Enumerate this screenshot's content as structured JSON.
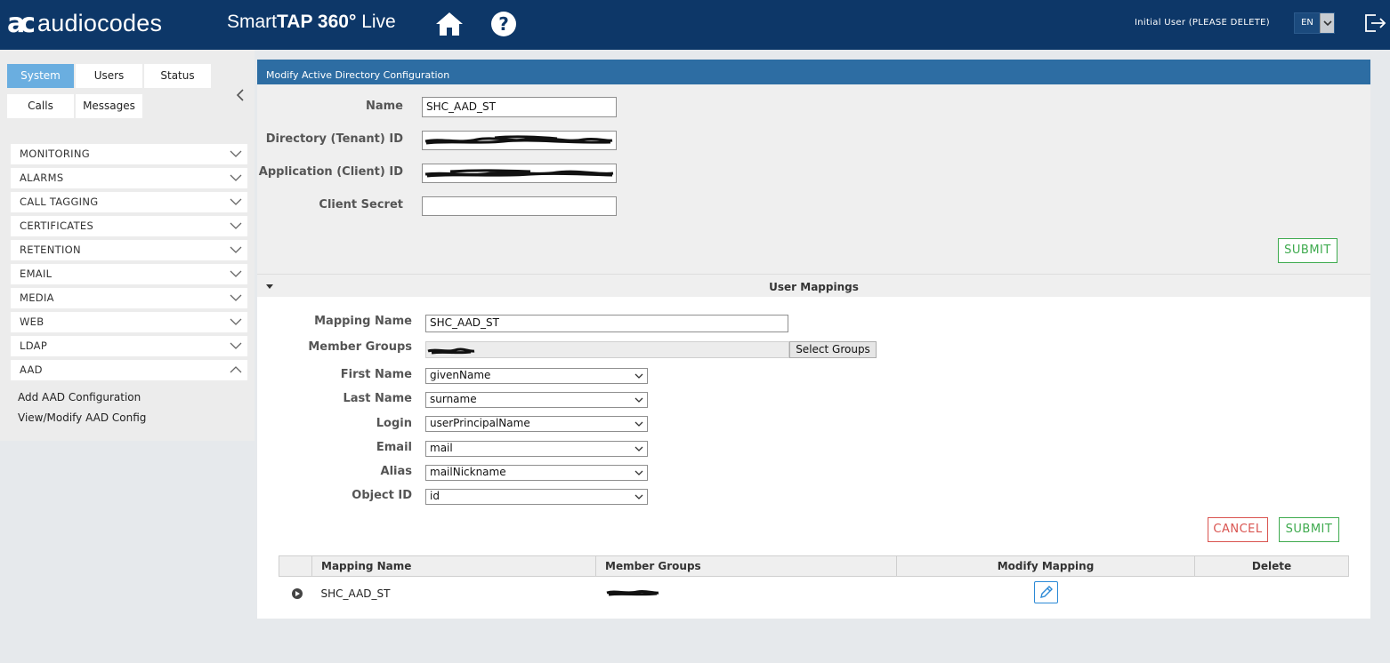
{
  "header": {
    "logo_mark": "ac",
    "logo_text": "audiocodes",
    "product_prefix": "Smart",
    "product_bold": "TAP 360°",
    "product_suffix": "Live",
    "user_label": "Initial User (PLEASE DELETE)",
    "language": "EN",
    "icons": [
      "home-icon",
      "help-icon",
      "logout-icon"
    ]
  },
  "sidebar": {
    "tabs_row1": [
      "System",
      "Users",
      "Status"
    ],
    "tabs_row2": [
      "Calls",
      "Messages"
    ],
    "active_tab": "System",
    "sections": [
      "MONITORING",
      "ALARMS",
      "CALL TAGGING",
      "CERTIFICATES",
      "RETENTION",
      "EMAIL",
      "MEDIA",
      "WEB",
      "LDAP",
      "AAD"
    ],
    "expanded_section": "AAD",
    "aad_links": [
      "Add AAD Configuration",
      "View/Modify AAD Config"
    ]
  },
  "config": {
    "title": "Modify Active Directory Configuration",
    "name_label": "Name",
    "name_value": "SHC_AAD_ST",
    "tenant_label": "Directory (Tenant) ID",
    "client_label": "Application (Client) ID",
    "secret_label": "Client Secret",
    "secret_value": "",
    "submit_label": "SUBMIT"
  },
  "mappings": {
    "section_title": "User Mappings",
    "mapping_name_label": "Mapping Name",
    "mapping_name_value": "SHC_AAD_ST",
    "member_groups_label": "Member Groups",
    "select_groups_label": "Select Groups",
    "first_name_label": "First Name",
    "first_name_value": "givenName",
    "last_name_label": "Last Name",
    "last_name_value": "surname",
    "login_label": "Login",
    "login_value": "userPrincipalName",
    "email_label": "Email",
    "email_value": "mail",
    "alias_label": "Alias",
    "alias_value": "mailNickname",
    "object_id_label": "Object ID",
    "object_id_value": "id",
    "cancel_label": "CANCEL",
    "submit_label": "SUBMIT"
  },
  "table": {
    "columns": [
      "Mapping Name",
      "Member Groups",
      "Modify Mapping",
      "Delete"
    ],
    "rows": [
      {
        "mapping_name": "SHC_AAD_ST"
      }
    ]
  }
}
